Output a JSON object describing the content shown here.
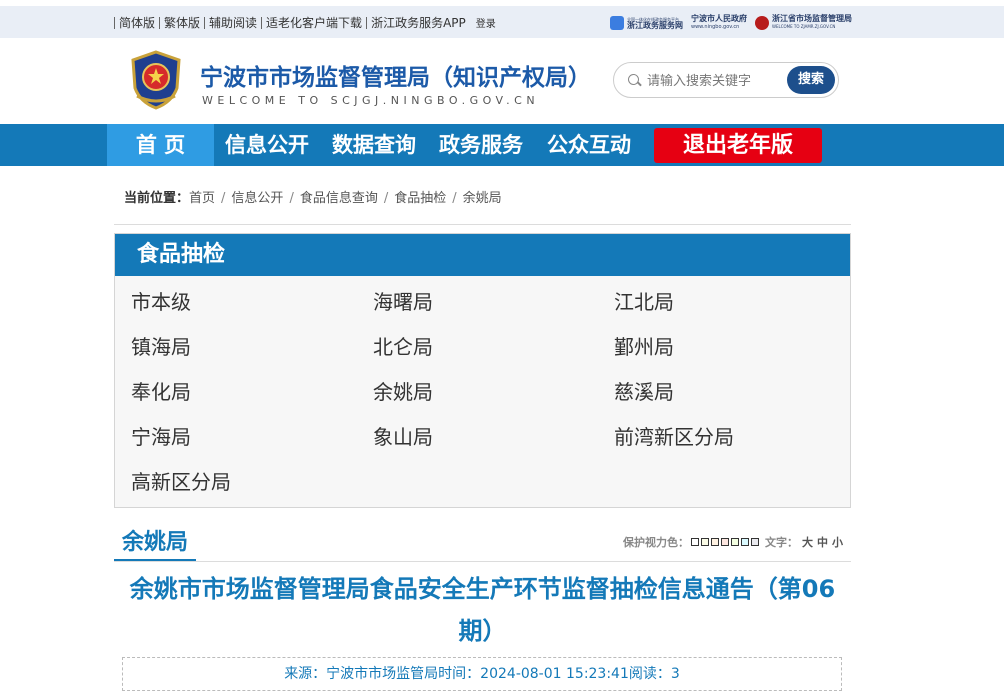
{
  "topbar": {
    "links": [
      "简体版",
      "繁体版",
      "辅助阅读",
      "适老化客户端下载",
      "浙江政务服务APP"
    ],
    "login": "登录",
    "logos": [
      {
        "line1": "全国一体化在线政务服务平台",
        "line2": "浙江政务服务网",
        "color": "#3b7de0"
      },
      {
        "line1": "宁波市人民政府",
        "line2": "www.ningbo.gov.cn",
        "color": "#c8302a"
      },
      {
        "line1": "浙江省市场监督管理局",
        "line2": "WELCOME TO ZJAMR.ZJ.GOV.CN",
        "color": "#b71c1c"
      }
    ]
  },
  "header": {
    "title": "宁波市市场监督管理局（知识产权局）",
    "subtitle": "WELCOME TO SCJGJ.NINGBO.GOV.CN",
    "search_placeholder": "请输入搜索关键字",
    "search_button": "搜索"
  },
  "nav": {
    "items": [
      "首 页",
      "信息公开",
      "数据查询",
      "政务服务",
      "公众互动"
    ],
    "exit": "退出老年版"
  },
  "breadcrumb": {
    "label": "当前位置：",
    "items": [
      "首页",
      "信息公开",
      "食品信息查询",
      "食品抽检",
      "余姚局"
    ]
  },
  "category": {
    "title": "食品抽检",
    "items": [
      "市本级",
      "海曙局",
      "江北局",
      "镇海局",
      "北仑局",
      "鄞州局",
      "奉化局",
      "余姚局",
      "慈溪局",
      "宁海局",
      "象山局",
      "前湾新区分局",
      "高新区分局"
    ]
  },
  "section": {
    "title": "余姚局",
    "eye_label": "保护视力色：",
    "swatches": [
      "#ffffff",
      "#fafbe6",
      "#fff2e2",
      "#fde6e0",
      "#f3ffe1",
      "#dafaff",
      "#eaeaef"
    ],
    "font_label": "文字：",
    "font_sizes": [
      "大",
      "中",
      "小"
    ]
  },
  "article": {
    "title": "余姚市市场监督管理局食品安全生产环节监督抽检信息通告（第06期）",
    "meta": "来源：宁波市市场监管局时间：2024-08-01 15:23:41阅读：3"
  }
}
